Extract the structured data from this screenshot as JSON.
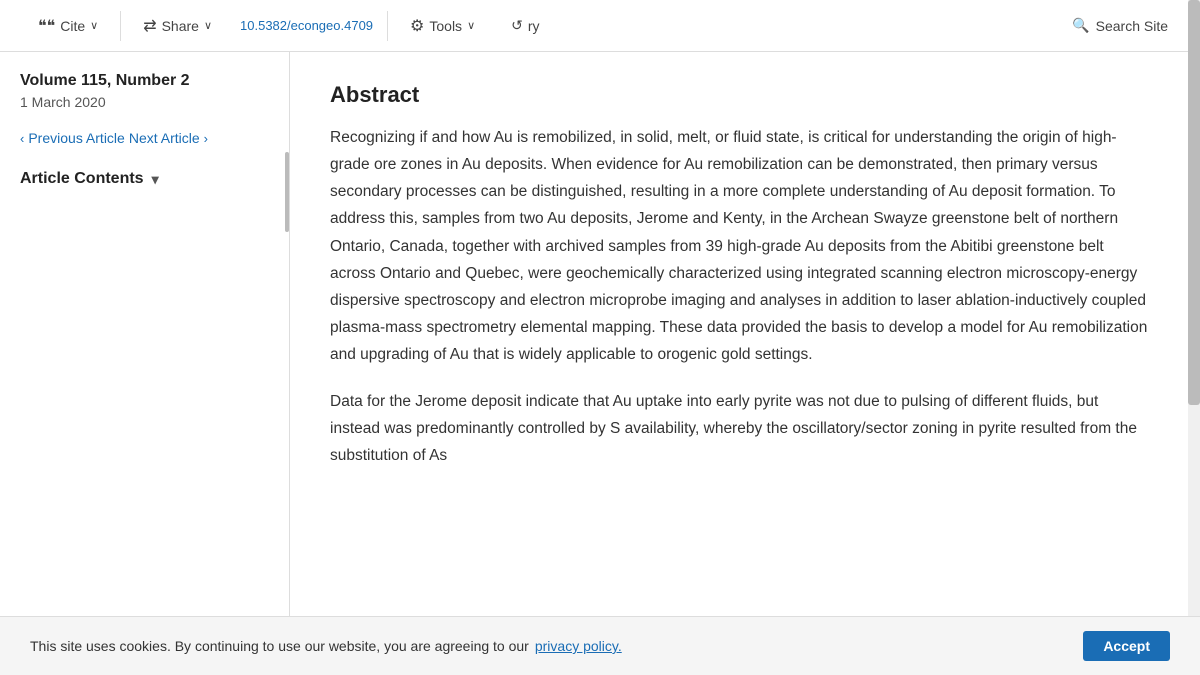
{
  "toolbar": {
    "cite_label": "Cite",
    "cite_icon": "❝",
    "share_label": "Share",
    "share_icon": "⇄",
    "doi": "10.5382/econgeo.4709",
    "tools_label": "Tools",
    "tools_icon": "⚙",
    "history_label": "ry",
    "history_icon": "↺",
    "search_label": "Search Site",
    "search_icon": "🔍"
  },
  "sidebar": {
    "volume_title": "Volume 115, Number 2",
    "volume_date": "1 March 2020",
    "prev_article": "Previous Article",
    "next_article": "Next Article",
    "contents_title": "Article Contents",
    "contents_toggle": "▾"
  },
  "content": {
    "abstract_title": "Abstract",
    "abstract_para1": "Recognizing if and how Au is remobilized, in solid, melt, or fluid state, is critical for understanding the origin of high-grade ore zones in Au deposits. When evidence for Au remobilization can be demonstrated, then primary versus secondary processes can be distinguished, resulting in a more complete understanding of Au deposit formation. To address this, samples from two Au deposits, Jerome and Kenty, in the Archean Swayze greenstone belt of northern Ontario, Canada, together with archived samples from 39 high-grade Au deposits from the Abitibi greenstone belt across Ontario and Quebec, were geochemically characterized using integrated scanning electron microscopy-energy dispersive spectroscopy and electron microprobe imaging and analyses in addition to laser ablation-inductively coupled plasma-mass spectrometry elemental mapping. These data provided the basis to develop a model for Au remobilization and upgrading of Au that is widely applicable to orogenic gold settings.",
    "abstract_para2": "Data for the Jerome deposit indicate that Au uptake into early pyrite was not due to pulsing of different fluids, but instead was predominantly controlled by S availability, whereby the oscillatory/sector zoning in pyrite resulted from the substitution of As"
  },
  "cookie_banner": {
    "text": "This site uses cookies. By continuing to use our website, you are agreeing to our",
    "link_text": "privacy policy.",
    "accept_label": "Accept"
  }
}
